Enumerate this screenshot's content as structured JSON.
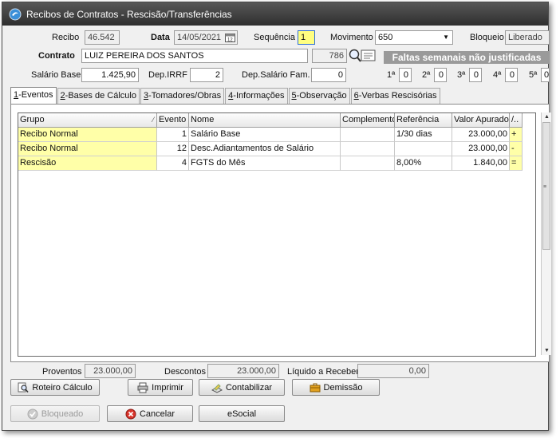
{
  "window": {
    "title": "Recibos de Contratos - Rescisão/Transferências"
  },
  "header": {
    "recibo_label": "Recibo",
    "recibo_value": "46.542",
    "data_label": "Data",
    "data_value": "14/05/2021",
    "sequencia_label": "Sequência",
    "sequencia_value": "1",
    "movimento_label": "Movimento",
    "movimento_value": "650",
    "bloqueio_label": "Bloqueio",
    "bloqueio_value": "Liberado",
    "contrato_label": "Contrato",
    "contrato_value": "LUIZ PEREIRA DOS SANTOS",
    "contrato_code": "786",
    "faltas_banner": "Faltas semanais não justificadas",
    "salario_label": "Salário Base",
    "salario_value": "1.425,90",
    "depirrf_label": "Dep.IRRF",
    "depirrf_value": "2",
    "depsal_label": "Dep.Salário Fam.",
    "depsal_value": "0",
    "weeks": [
      {
        "label": "1ª",
        "value": "0"
      },
      {
        "label": "2ª",
        "value": "0"
      },
      {
        "label": "3ª",
        "value": "0"
      },
      {
        "label": "4ª",
        "value": "0"
      },
      {
        "label": "5ª",
        "value": "0"
      }
    ]
  },
  "tabs": [
    {
      "key": "1",
      "label": "-Eventos"
    },
    {
      "key": "2",
      "label": "-Bases de Cálculo"
    },
    {
      "key": "3",
      "label": "-Tomadores/Obras"
    },
    {
      "key": "4",
      "label": "-Informações"
    },
    {
      "key": "5",
      "label": "-Observação"
    },
    {
      "key": "6",
      "label": "-Verbas Rescisórias"
    }
  ],
  "grid": {
    "columns": [
      "Grupo",
      "Evento",
      "Nome",
      "Complemento",
      "Referência",
      "Valor Apurado",
      "/.."
    ],
    "rows": [
      [
        "Recibo Normal",
        "1",
        "Salário Base",
        "",
        "1/30 dias",
        "23.000,00",
        "+"
      ],
      [
        "Recibo Normal",
        "12",
        "Desc.Adiantamentos de Salário",
        "",
        "",
        "23.000,00",
        "-"
      ],
      [
        "Rescisão",
        "4",
        "FGTS do Mês",
        "",
        "8,00%",
        "1.840,00",
        "="
      ]
    ]
  },
  "totals": {
    "proventos_label": "Proventos",
    "proventos_value": "23.000,00",
    "descontos_label": "Descontos",
    "descontos_value": "23.000,00",
    "liquido_label": "Líquido a Receber",
    "liquido_value": "0,00"
  },
  "buttons": {
    "roteiro": "Roteiro Cálculo",
    "imprimir": "Imprimir",
    "contabilizar": "Contabilizar",
    "demissao": "Demissão",
    "bloqueado": "Bloqueado",
    "cancelar": "Cancelar",
    "esocial": "eSocial"
  },
  "colors": {
    "group_cell": "#ffffa8",
    "banner": "#9a9a9a",
    "titlebar": "#3a3a3a"
  }
}
